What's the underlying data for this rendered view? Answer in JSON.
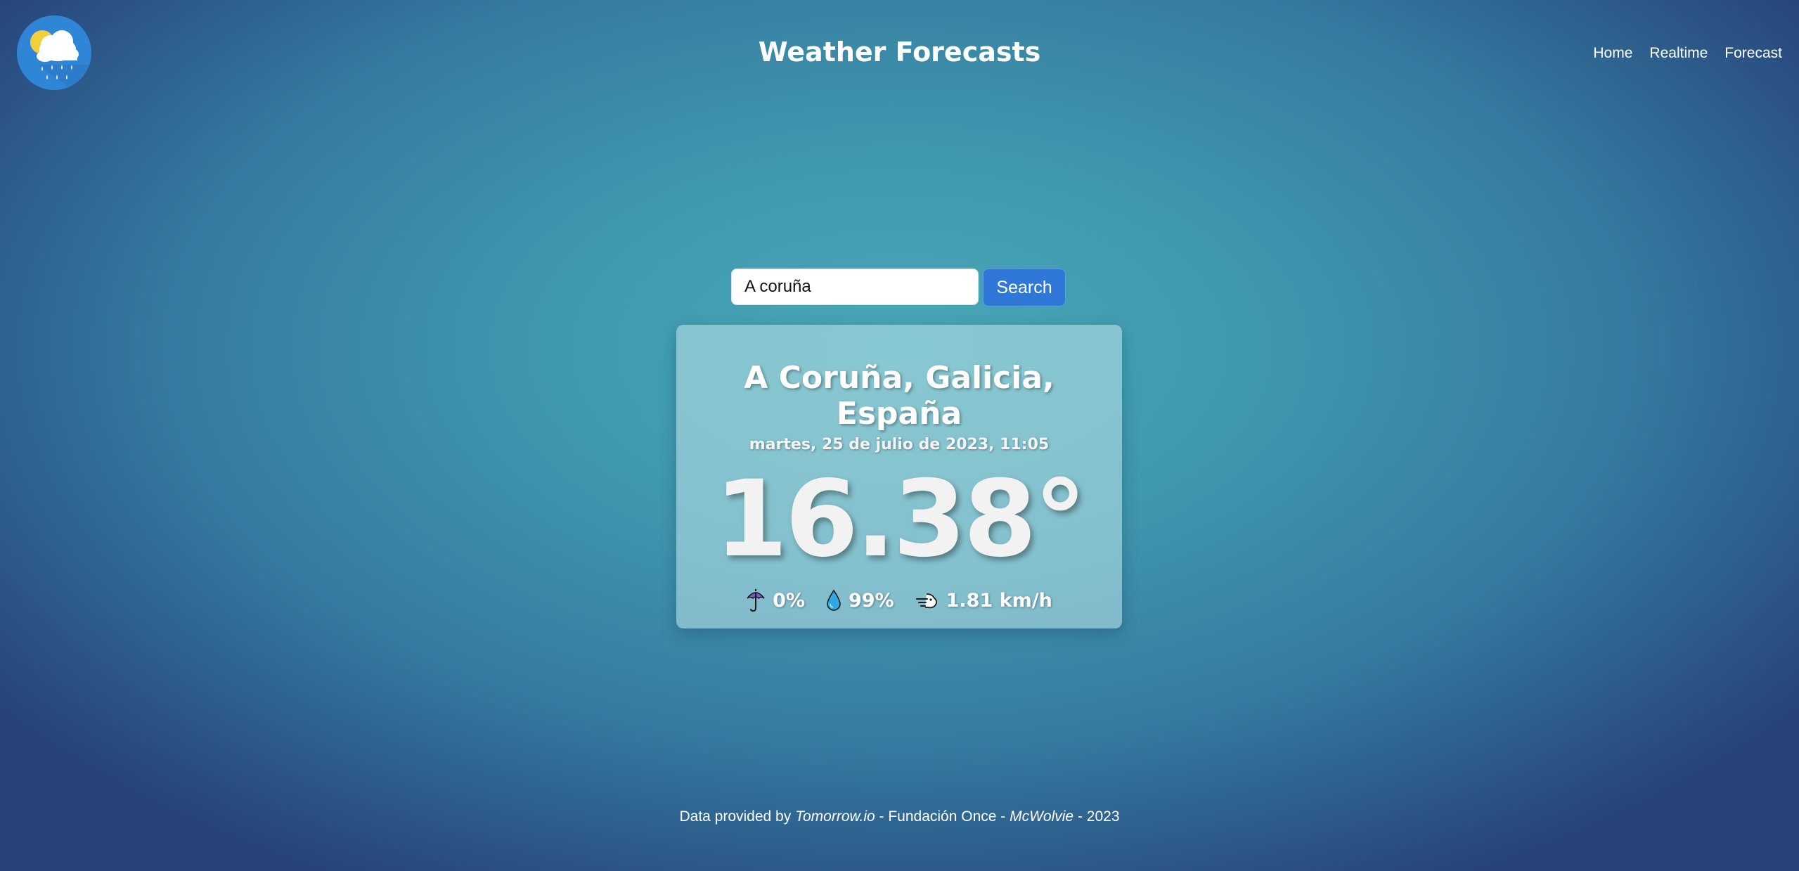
{
  "header": {
    "title": "Weather Forecasts",
    "logo_icon": "weather-cloud-sun-rain-icon",
    "nav": [
      {
        "label": "Home"
      },
      {
        "label": "Realtime"
      },
      {
        "label": "Forecast"
      }
    ]
  },
  "search": {
    "value": "A coruña",
    "button_label": "Search"
  },
  "weather": {
    "location": "A Coruña, Galicia, España",
    "datetime": "martes, 25 de julio de 2023, 11:05",
    "temperature": "16.38°",
    "precipitation": {
      "icon": "umbrella-icon",
      "value": "0%"
    },
    "humidity": {
      "icon": "droplet-icon",
      "value": "99%"
    },
    "wind": {
      "icon": "wind-icon",
      "value": "1.81 km/h"
    }
  },
  "footer": {
    "prefix": "Data provided by ",
    "provider": "Tomorrow.io",
    "sep1": " - Fundación Once - ",
    "author": "McWolvie",
    "sep2": " - 2023"
  },
  "colors": {
    "background_center": "#48a7b6",
    "background_edge": "#27437a",
    "button": "#2f78d8",
    "logo_bg": "#2f86d6"
  }
}
